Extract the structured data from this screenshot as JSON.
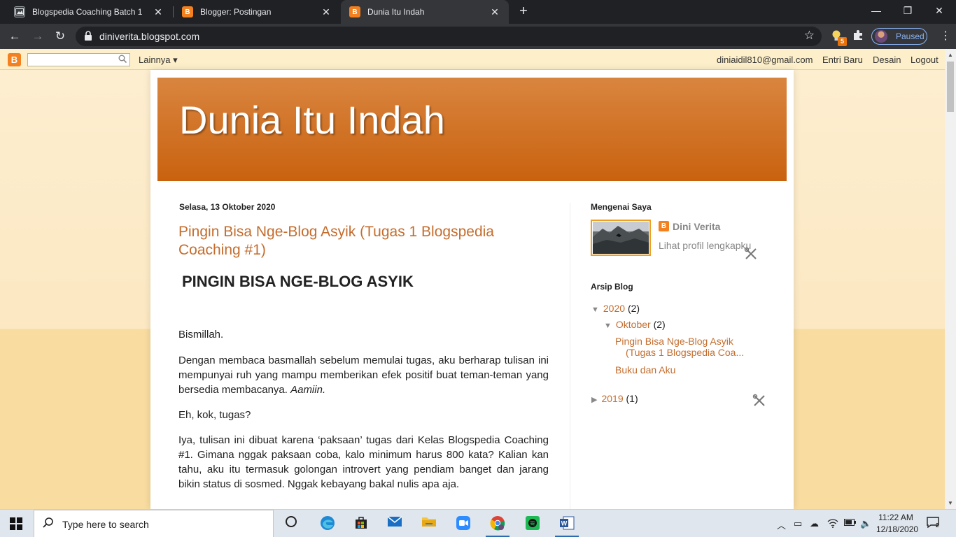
{
  "browser": {
    "tabs": [
      {
        "title": "Blogspedia Coaching Batch 1"
      },
      {
        "title": "Blogger: Postingan"
      },
      {
        "title": "Dunia Itu Indah"
      }
    ],
    "url": "diniverita.blogspot.com",
    "profile_status": "Paused",
    "extension_badge": "5"
  },
  "navbar": {
    "more_label": "Lainnya ▾",
    "email": "diniaidil810@gmail.com",
    "new_post": "Entri Baru",
    "design": "Desain",
    "logout": "Logout"
  },
  "blog": {
    "title": "Dunia Itu Indah"
  },
  "post": {
    "date": "Selasa, 13 Oktober 2020",
    "title": "Pingin Bisa Nge-Blog Asyik (Tugas 1 Blogspedia Coaching #1)",
    "heading": "PINGIN BISA NGE-BLOG ASYIK",
    "p1": "Bismillah.",
    "p2a": "Dengan membaca basmallah sebelum memulai tugas, aku berharap tulisan ini mempunyai ruh yang mampu memberikan efek positif buat teman-teman yang bersedia membacanya. ",
    "p2b": "Aamiin.",
    "p3": "Eh, kok, tugas?",
    "p4": "Iya, tulisan ini dibuat karena ‘paksaan’ tugas dari Kelas Blogspedia Coaching #1. Gimana nggak paksaan coba, kalo minimum harus 800 kata? Kalian kan tahu, aku itu termasuk golongan introvert yang pendiam banget dan jarang bikin status di sosmed. Nggak kebayang bakal nulis apa aja."
  },
  "sidebar": {
    "about_heading": "Mengenai Saya",
    "profile_name": "Dini Verita",
    "profile_link": "Lihat profil lengkapku",
    "archive_heading": "Arsip Blog",
    "archive": {
      "y2020": "2020",
      "y2020_count": "(2)",
      "oct": "Oktober",
      "oct_count": "(2)",
      "post1_line1": "Pingin Bisa Nge-Blog Asyik",
      "post1_line2": "(Tugas 1 Blogspedia Coa...",
      "post2": "Buku dan Aku",
      "y2019": "2019",
      "y2019_count": "(1)"
    }
  },
  "taskbar": {
    "search_placeholder": "Type here to search",
    "time": "11:22 AM",
    "date": "12/18/2020"
  },
  "colors": {
    "accent_link": "#c46d2d",
    "header_orange": "#c9620f",
    "blogger_orange": "#f48120"
  }
}
